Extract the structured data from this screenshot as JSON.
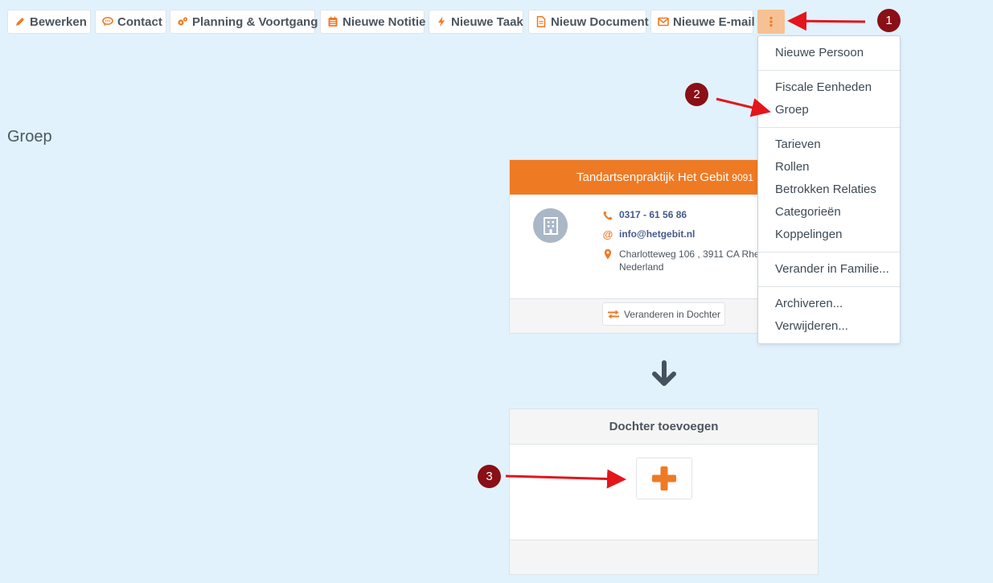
{
  "toolbar": {
    "buttons": [
      {
        "label": "Bewerken",
        "icon": "pencil-icon"
      },
      {
        "label": "Contact",
        "icon": "chat-icon"
      },
      {
        "label": "Planning & Voortgang",
        "icon": "gears-icon"
      },
      {
        "label": "Nieuwe Notitie",
        "icon": "note-icon"
      },
      {
        "label": "Nieuwe Taak",
        "icon": "bolt-icon"
      },
      {
        "label": "Nieuw Document",
        "icon": "document-icon"
      },
      {
        "label": "Nieuwe E-mail",
        "icon": "envelope-icon"
      }
    ],
    "more_icon": "vertical-ellipsis-icon"
  },
  "dropdown": {
    "groups": [
      [
        "Nieuwe Persoon"
      ],
      [
        "Fiscale Eenheden",
        "Groep"
      ],
      [
        "Tarieven",
        "Rollen",
        "Betrokken Relaties",
        "Categorieën",
        "Koppelingen"
      ],
      [
        "Verander in Familie..."
      ],
      [
        "Archiveren...",
        "Verwijderen..."
      ]
    ]
  },
  "page": {
    "title": "Groep"
  },
  "org_card": {
    "name": "Tandartsenpraktijk Het Gebit",
    "number": "9091",
    "avatar_icon": "building-icon",
    "phone": "0317 - 61 56 86",
    "email": "info@hetgebit.nl",
    "address_line1": "Charlotteweg 106 , 3911 CA Rhen",
    "address_line2": "Nederland",
    "switch_label": "Veranderen in Dochter"
  },
  "add_card": {
    "title": "Dochter toevoegen",
    "add_icon": "plus-icon"
  },
  "annotations": {
    "markers": [
      "1",
      "2",
      "3"
    ]
  },
  "colors": {
    "accent": "#ef7a24",
    "background": "#e1f2fd",
    "marker": "#8a0f16",
    "arrow": "#e3161b"
  }
}
